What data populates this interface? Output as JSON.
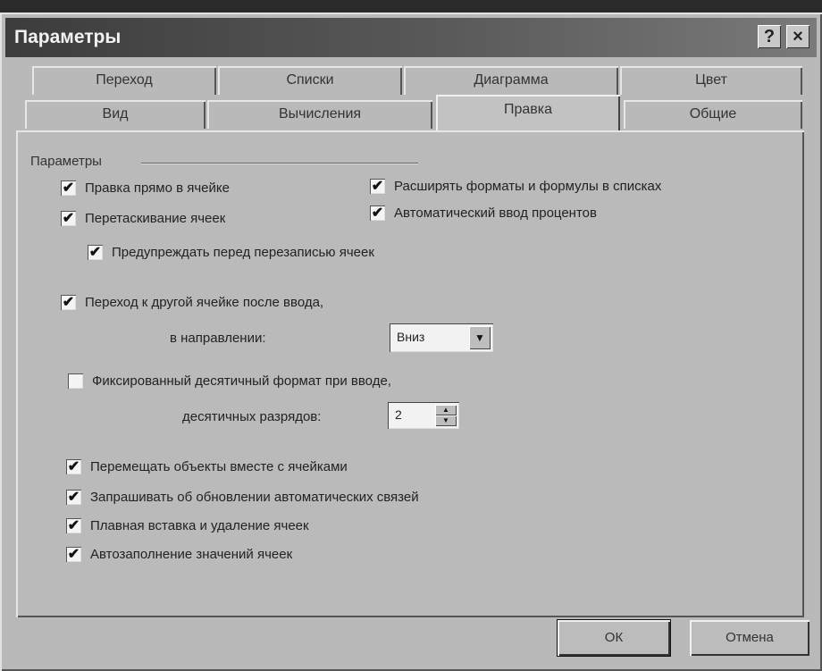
{
  "window": {
    "title": "Параметры",
    "help_label": "?",
    "close_label": "×"
  },
  "tabs_back": [
    "Переход",
    "Списки",
    "Диаграмма",
    "Цвет"
  ],
  "tabs_front": [
    "Вид",
    "Вычисления",
    "Правка",
    "Общие"
  ],
  "active_tab": "Правка",
  "group": {
    "label": "Параметры"
  },
  "options": {
    "edit_in_cell": {
      "label": "Правка прямо в ячейке",
      "checked": true
    },
    "drag_drop": {
      "label": "Перетаскивание ячеек",
      "checked": true
    },
    "alert_overwrite": {
      "label": "Предупреждать перед перезаписью ячеек",
      "checked": true
    },
    "extend_formats": {
      "label": "Расширять форматы и формулы в списках",
      "checked": true
    },
    "auto_percent": {
      "label": "Автоматический ввод процентов",
      "checked": true
    },
    "move_after_enter": {
      "label": "Переход к другой ячейке после ввода,",
      "checked": true
    },
    "fixed_decimal": {
      "label": "Фиксированный десятичный формат при вводе,",
      "checked": false
    },
    "cut_copy_sort": {
      "label": "Перемещать объекты вместе с ячейками",
      "checked": true
    },
    "ask_update_links": {
      "label": "Запрашивать об обновлении автоматических связей",
      "checked": true
    },
    "smooth_insert": {
      "label": "Плавная вставка и удаление ячеек",
      "checked": true
    },
    "autocomplete": {
      "label": "Автозаполнение значений ячеек",
      "checked": true
    }
  },
  "direction": {
    "label": "в направлении:",
    "value": "Вниз",
    "arrow": "▼"
  },
  "decimals": {
    "label": "десятичных разрядов:",
    "value": "2",
    "up": "▲",
    "down": "▼"
  },
  "buttons": {
    "ok": "ОК",
    "cancel": "Отмена"
  }
}
